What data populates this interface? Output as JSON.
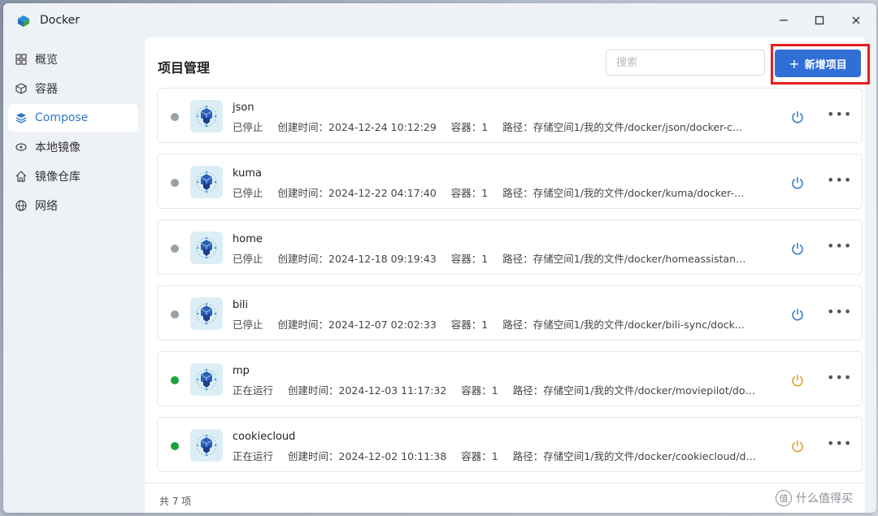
{
  "window": {
    "title": "Docker"
  },
  "sidebar": {
    "items": [
      {
        "label": "概览",
        "icon": "grid-icon",
        "active": false
      },
      {
        "label": "容器",
        "icon": "cube-icon",
        "active": false
      },
      {
        "label": "Compose",
        "icon": "layers-icon",
        "active": true
      },
      {
        "label": "本地镜像",
        "icon": "disk-icon",
        "active": false
      },
      {
        "label": "镜像仓库",
        "icon": "house-icon",
        "active": false
      },
      {
        "label": "网络",
        "icon": "globe-icon",
        "active": false
      }
    ]
  },
  "main": {
    "title": "项目管理",
    "search_placeholder": "搜索",
    "add_button": "新增项目",
    "total": "共 7 项"
  },
  "projects": [
    {
      "name": "json",
      "status": "已停止",
      "running": false,
      "created": "创建时间：2024-12-24 10:12:29",
      "containers": "容器：1",
      "path": "路径：存储空间1/我的文件/docker/json/docker-compose.y..."
    },
    {
      "name": "kuma",
      "status": "已停止",
      "running": false,
      "created": "创建时间：2024-12-22 04:17:40",
      "containers": "容器：1",
      "path": "路径：存储空间1/我的文件/docker/kuma/docker-compose..."
    },
    {
      "name": "home",
      "status": "已停止",
      "running": false,
      "created": "创建时间：2024-12-18 09:19:43",
      "containers": "容器：1",
      "path": "路径：存储空间1/我的文件/docker/homeassistant/docker-..."
    },
    {
      "name": "bili",
      "status": "已停止",
      "running": false,
      "created": "创建时间：2024-12-07 02:02:33",
      "containers": "容器：1",
      "path": "路径：存储空间1/我的文件/docker/bili-sync/docker-comp..."
    },
    {
      "name": "mp",
      "status": "正在运行",
      "running": true,
      "created": "创建时间：2024-12-03 11:17:32",
      "containers": "容器：1",
      "path": "路径：存储空间1/我的文件/docker/moviepilot/docker-c..."
    },
    {
      "name": "cookiecloud",
      "status": "正在运行",
      "running": true,
      "created": "创建时间：2024-12-02 10:11:38",
      "containers": "容器：1",
      "path": "路径：存储空间1/我的文件/docker/cookiecloud/docker-..."
    }
  ],
  "colors": {
    "stopped": "#9aa0a8",
    "running": "#1aa33a",
    "power_stopped": "#3b7fc8",
    "power_running": "#e0a23a",
    "accent": "#2f6fd6"
  },
  "watermark": "什么值得买"
}
